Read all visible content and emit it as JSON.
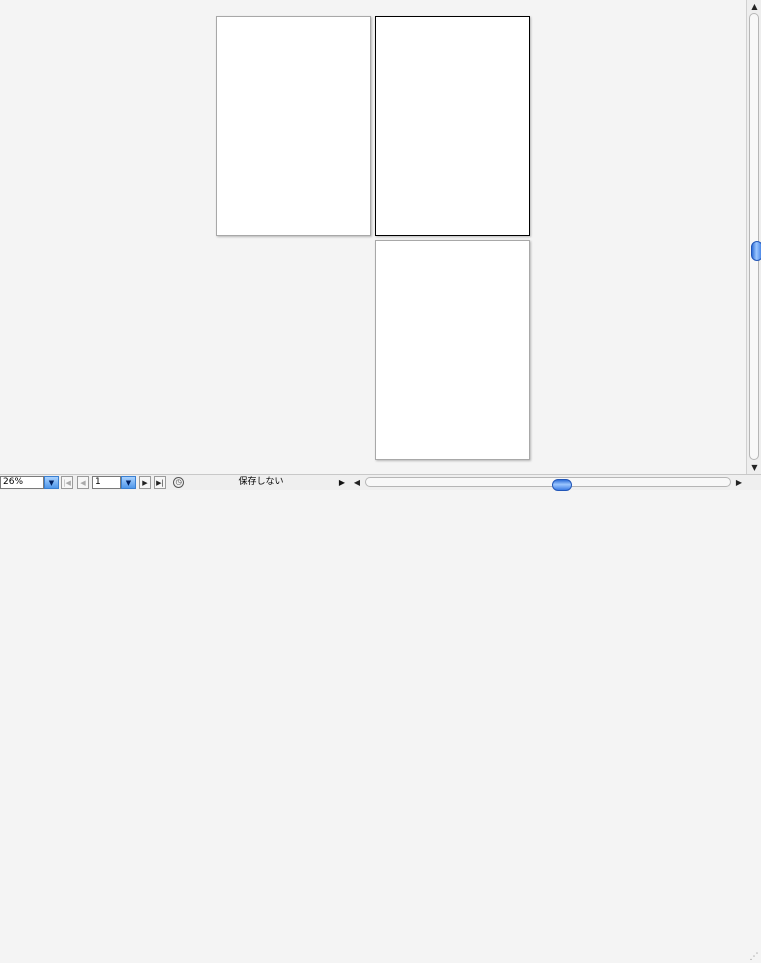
{
  "artboards": [
    {
      "name": "artboard-1",
      "active": false
    },
    {
      "name": "artboard-2",
      "active": true
    },
    {
      "name": "artboard-3",
      "active": false
    }
  ],
  "bottombar": {
    "zoom_value": "26%",
    "page_value": "1",
    "status_text": "保存しない",
    "icons": {
      "zoom_dropdown": "chevron-down-icon",
      "first": "first-page-icon",
      "prev": "previous-page-icon",
      "page_dropdown": "chevron-down-icon",
      "next": "next-page-icon",
      "last": "last-page-icon",
      "status": "clock-icon",
      "status_menu": "triangle-right-icon"
    }
  },
  "colors": {
    "canvas": "#f4f4f4",
    "scroll_thumb": "#3b7be4",
    "dropdown_accent": "#4f97ea"
  }
}
